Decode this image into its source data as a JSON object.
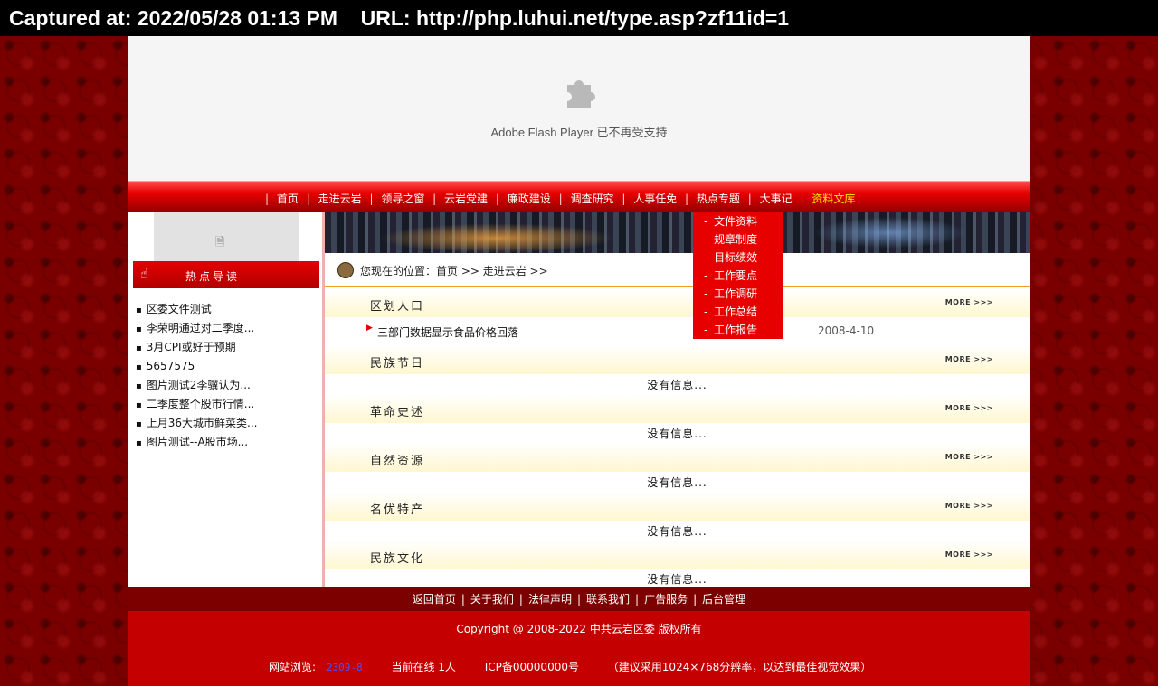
{
  "capture_bar": {
    "text": "Captured at: 2022/05/28 01:13 PM    URL: http://php.luhui.net/type.asp?zf11id=1"
  },
  "flash": {
    "message": "Adobe Flash Player 已不再受支持"
  },
  "nav": {
    "items": [
      {
        "label": "首页"
      },
      {
        "label": "走进云岩"
      },
      {
        "label": "领导之窗"
      },
      {
        "label": "云岩党建"
      },
      {
        "label": "廉政建设"
      },
      {
        "label": "调查研究"
      },
      {
        "label": "人事任免"
      },
      {
        "label": "热点专题"
      },
      {
        "label": "大事记"
      },
      {
        "label": "资料文库"
      }
    ],
    "active_color": "#ffe600"
  },
  "dropdown": {
    "items": [
      "文件资料",
      "规章制度",
      "目标绩效",
      "工作要点",
      "工作调研",
      "工作总结",
      "工作报告"
    ]
  },
  "sidebar": {
    "hot_title": "热点导读",
    "hot_items": [
      "区委文件测试",
      "李荣明通过对二季度...",
      "3月CPI或好于预期",
      "5657575",
      "图片测试2李骥认为...",
      "二季度整个股市行情...",
      "上月36大城市鲜菜类...",
      "图片测试--A股市场..."
    ]
  },
  "location": {
    "text": "您现在的位置：首页 >> 走进云岩 >>"
  },
  "sections": [
    {
      "title": "区划人口",
      "more": "MORE >>>",
      "articles": [
        {
          "title": "三部门数据显示食品价格回落",
          "date": "2008-4-10"
        }
      ]
    },
    {
      "title": "民族节日",
      "more": "MORE >>>",
      "empty": "没有信息..."
    },
    {
      "title": "革命史述",
      "more": "MORE >>>",
      "empty": "没有信息..."
    },
    {
      "title": "自然资源",
      "more": "MORE >>>",
      "empty": "没有信息..."
    },
    {
      "title": "名优特产",
      "more": "MORE >>>",
      "empty": "没有信息..."
    },
    {
      "title": "民族文化",
      "more": "MORE >>>",
      "empty": "没有信息..."
    }
  ],
  "footer": {
    "links": [
      "返回首页",
      "关于我们",
      "法律声明",
      "联系我们",
      "广告服务",
      "后台管理"
    ],
    "copyright": "Copyright @ 2008-2022  中共云岩区委  版权所有",
    "visits_label": "网站浏览:",
    "visits_value": "2309-8",
    "online": "当前在线 1人",
    "icp": "ICP备00000000号",
    "advice": "（建议采用1024×768分辨率，以达到最佳视觉效果）"
  },
  "colors": {
    "brand_red": "#e60000",
    "dark_red": "#7c0000",
    "bg_red": "#7a0000",
    "accent_orange": "#f0a030"
  }
}
